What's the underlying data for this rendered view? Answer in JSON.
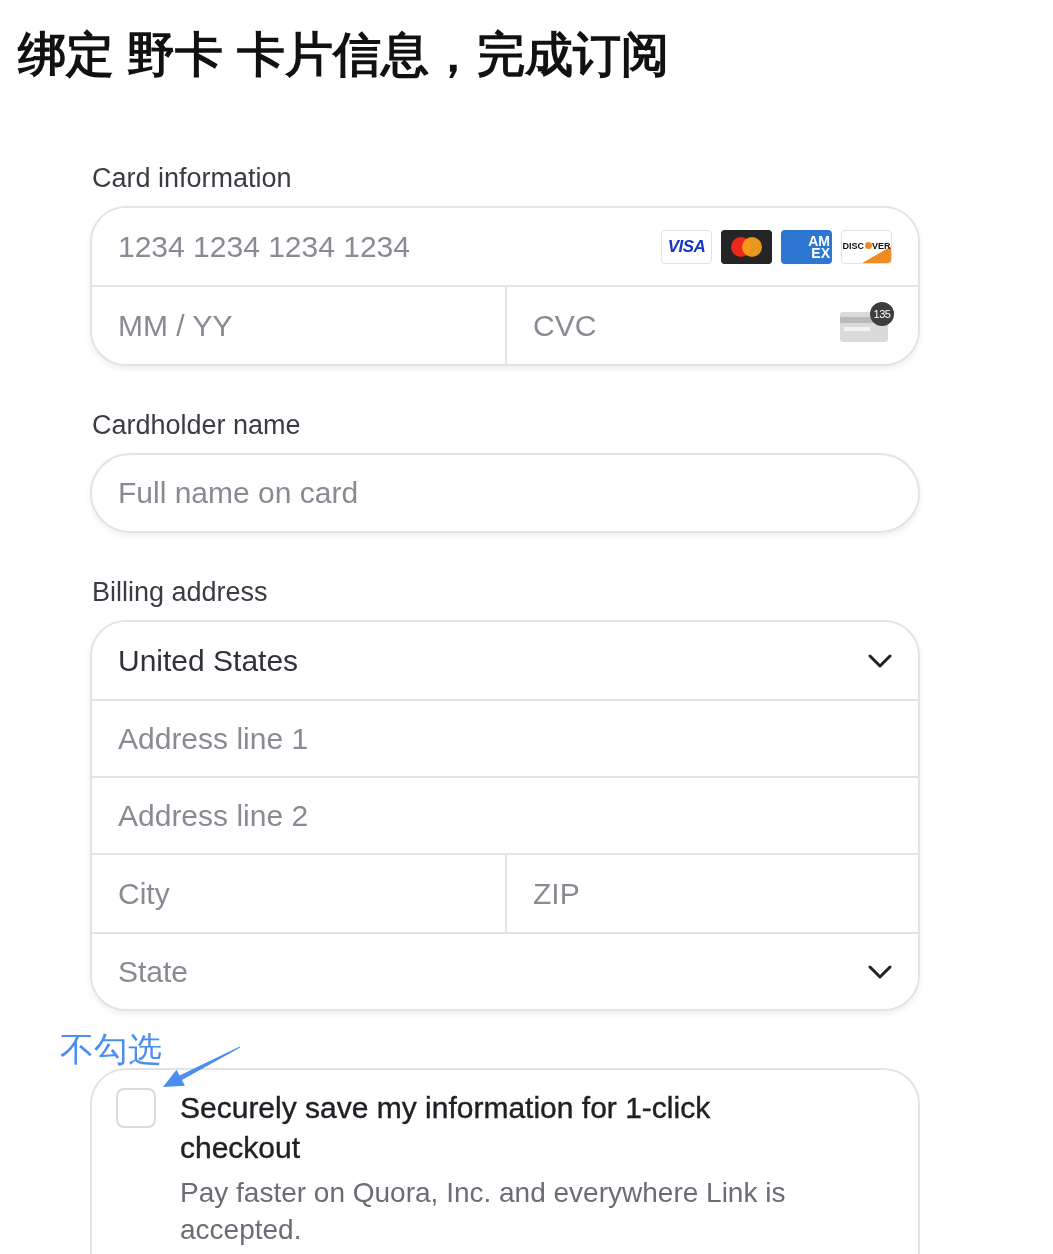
{
  "title": "绑定 野卡 卡片信息，完成订阅",
  "card_information": {
    "label": "Card information",
    "number": {
      "placeholder": "1234 1234 1234 1234"
    },
    "brands": [
      {
        "kind": "visa",
        "text": "VISA"
      },
      {
        "kind": "mastercard"
      },
      {
        "kind": "amex",
        "lines": [
          "AM",
          "EX"
        ]
      },
      {
        "kind": "discover",
        "parts": [
          "DISC",
          "VER"
        ]
      }
    ],
    "expiry": {
      "placeholder": "MM / YY"
    },
    "cvc": {
      "placeholder": "CVC",
      "badge": "135"
    }
  },
  "cardholder_name": {
    "label": "Cardholder name",
    "placeholder": "Full name on card"
  },
  "billing_address": {
    "label": "Billing address",
    "fields": [
      {
        "kind": "select",
        "value": "United States"
      },
      {
        "kind": "input",
        "placeholder": "Address line 1"
      },
      {
        "kind": "input",
        "placeholder": "Address line 2"
      },
      {
        "kind": "pair",
        "fields": [
          {
            "placeholder": "City"
          },
          {
            "placeholder": "ZIP"
          }
        ]
      },
      {
        "kind": "select",
        "placeholder": "State"
      }
    ]
  },
  "annotation": {
    "text": "不勾选"
  },
  "save_option": {
    "checked": false,
    "title": "Securely save my information for 1-click checkout",
    "description": "Pay faster on Quora, Inc. and everywhere Link is accepted."
  }
}
